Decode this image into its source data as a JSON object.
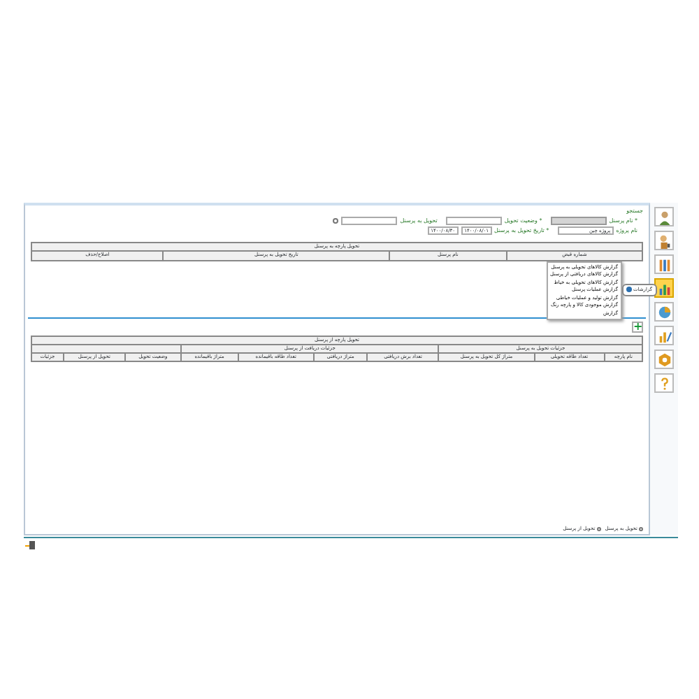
{
  "search_title": "جستجو",
  "filters": [
    {
      "kind": "text",
      "label": "* نام پرسنل",
      "disabled": true
    },
    {
      "kind": "select",
      "label": "* وضعیت تحویل",
      "disabled": false
    },
    {
      "kind": "check-text",
      "label": "تحویل به پرسنل",
      "checked": false
    },
    {
      "kind": "select",
      "label": "نام پروژه",
      "value": "پروژه چین",
      "disabled": false
    },
    {
      "kind": "date-range",
      "label": "* تاریخ تحویل به پرسنل",
      "from": "۱۴۰۰/۰۸/۰۱",
      "to": "۱۴۰۰/۰۸/۳۰"
    }
  ],
  "table1": {
    "group": "تحویل پارچه به پرسنل",
    "columns": [
      "شماره قبض",
      "نام پرسنل",
      "تاریخ تحویل به پرسنل",
      "اصلاح/حذف"
    ]
  },
  "menu": {
    "tooltip": "گزارشات",
    "items": [
      "گزارش کالاهای تحویلی به پرسنل",
      "گزارش کالاهای دریافتی از پرسنل",
      "گزارش کالاهای تحویلی به خیاط",
      "گزارش عملیات پرسنل",
      "گزارش تولید و عملیات خیاطی",
      "گزارش موجودی کالا و پارچه رنگ",
      "گزارش"
    ]
  },
  "add_button": "+",
  "table2": {
    "group": "تحویل پارچه از پرسنل",
    "subgroups": [
      {
        "label": "جزئیات تحویل به پرسنل",
        "columns": [
          "نام پارچه",
          "تعداد طاقه تحویلی",
          "متراژ کل تحویل به پرسنل"
        ]
      },
      {
        "label": "جزئیات دریافت از پرسنل",
        "columns": [
          "تعداد برش دریافتی",
          "متراژ دریافتی",
          "تعداد طاقه باقیمانده",
          "متراژ باقیمانده"
        ]
      },
      {
        "columns": [
          "وضعیت تحویل",
          "تحویل از پرسنل",
          "جزئیات"
        ]
      }
    ]
  },
  "footer_checks": [
    {
      "label": "تحویل به پرسنل",
      "checked": false
    },
    {
      "label": "تحویل از پرسنل",
      "checked": false
    }
  ],
  "sidebar": [
    {
      "kind": "user",
      "selected": false
    },
    {
      "kind": "user-key",
      "selected": false
    },
    {
      "kind": "columns",
      "selected": false
    },
    {
      "kind": "chart",
      "selected": true
    },
    {
      "kind": "pie",
      "selected": false
    },
    {
      "kind": "chart-pen",
      "selected": false
    },
    {
      "kind": "gear",
      "selected": false
    },
    {
      "kind": "help",
      "selected": false
    }
  ]
}
